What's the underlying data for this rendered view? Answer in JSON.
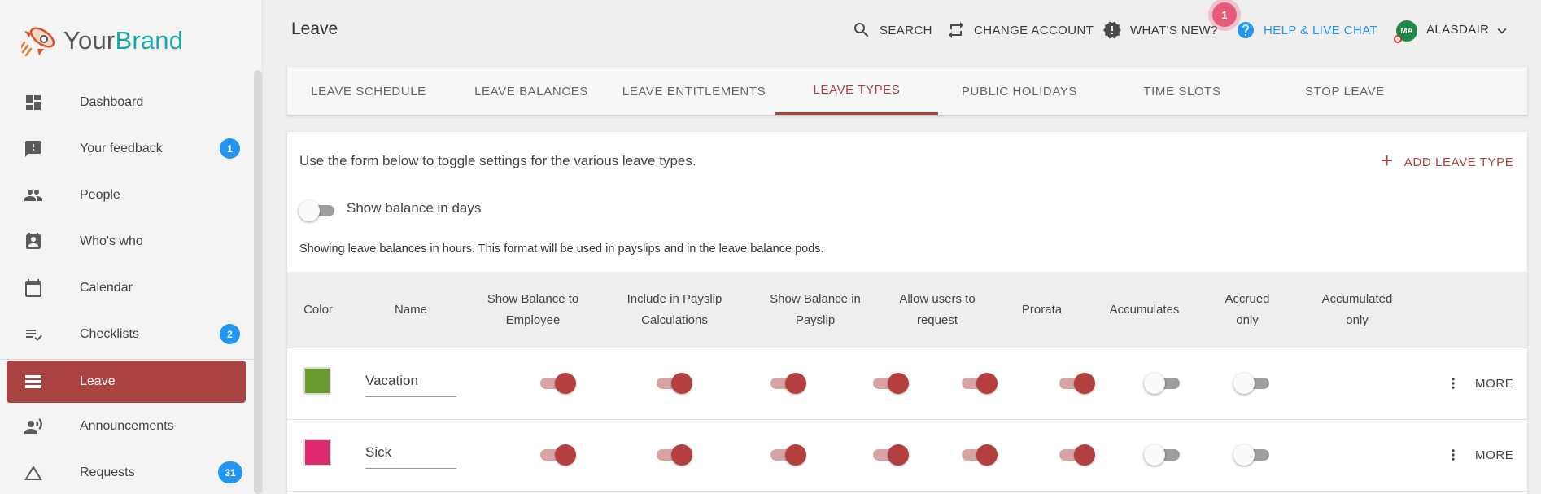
{
  "brand": {
    "part1": "Your",
    "part2": "Brand"
  },
  "colors": {
    "accent": "#a94442",
    "badge": "#2196f3",
    "help": "#2196f3",
    "vacation": "#6b9b2e",
    "sick": "#e0286f"
  },
  "sidebar": {
    "items": [
      {
        "label": "Dashboard",
        "icon": "dashboard-icon",
        "badge": null
      },
      {
        "label": "Your feedback",
        "icon": "feedback-icon",
        "badge": "1"
      },
      {
        "label": "People",
        "icon": "people-icon",
        "badge": null
      },
      {
        "label": "Who's who",
        "icon": "contact-card-icon",
        "badge": null
      },
      {
        "label": "Calendar",
        "icon": "calendar-icon",
        "badge": null
      },
      {
        "label": "Checklists",
        "icon": "checklist-icon",
        "badge": "2"
      },
      {
        "label": "Leave",
        "icon": "leave-icon",
        "badge": null,
        "active": true
      },
      {
        "label": "Announcements",
        "icon": "megaphone-icon",
        "badge": null
      },
      {
        "label": "Requests",
        "icon": "triangle-icon",
        "badge": "31"
      }
    ]
  },
  "header": {
    "title": "Leave",
    "search": "SEARCH",
    "change_account": "CHANGE ACCOUNT",
    "whats_new": "WHAT'S NEW?",
    "whats_new_count": "1",
    "help": "HELP & LIVE CHAT",
    "avatar_initials": "MA",
    "user": "ALASDAIR"
  },
  "tabs": [
    {
      "label": "LEAVE SCHEDULE"
    },
    {
      "label": "LEAVE BALANCES"
    },
    {
      "label": "LEAVE ENTITLEMENTS"
    },
    {
      "label": "LEAVE TYPES",
      "active": true
    },
    {
      "label": "PUBLIC HOLIDAYS"
    },
    {
      "label": "TIME SLOTS"
    },
    {
      "label": "STOP LEAVE"
    }
  ],
  "main": {
    "intro": "Use the form below to toggle settings for the various leave types.",
    "add_button": "ADD LEAVE TYPE",
    "show_days_label": "Show balance in days",
    "show_days_on": false,
    "info": "Showing leave balances in hours. This format will be used in payslips and in the leave balance pods."
  },
  "table": {
    "columns": [
      "Color",
      "Name",
      "Show Balance to Employee",
      "Include in Payslip Calculations",
      "Show Balance in Payslip",
      "Allow users to request",
      "Prorata",
      "Accumulates",
      "Accrued only",
      "Accumulated only"
    ],
    "rows": [
      {
        "name": "Vacation",
        "color": "#6b9b2e",
        "toggles": [
          true,
          true,
          true,
          true,
          true,
          true,
          false,
          false
        ],
        "more": "MORE"
      },
      {
        "name": "Sick",
        "color": "#e0286f",
        "toggles": [
          true,
          true,
          true,
          true,
          true,
          true,
          false,
          false
        ],
        "more": "MORE"
      }
    ]
  }
}
